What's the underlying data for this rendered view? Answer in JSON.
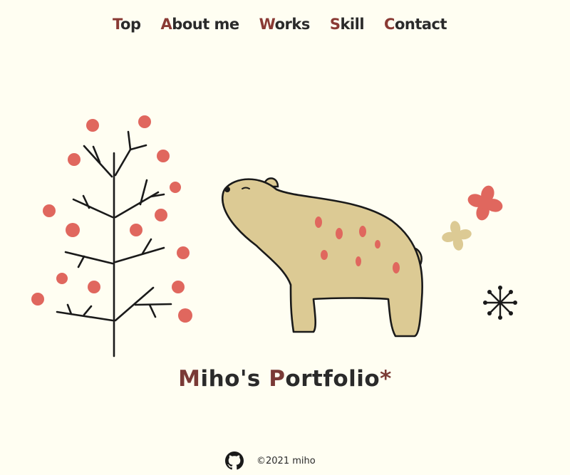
{
  "nav": {
    "items": [
      {
        "first": "T",
        "rest": "op"
      },
      {
        "first": "A",
        "rest": "bout me"
      },
      {
        "first": "W",
        "rest": "orks"
      },
      {
        "first": "S",
        "rest": "kill"
      },
      {
        "first": "C",
        "rest": "ontact"
      }
    ]
  },
  "hero": {
    "title_part1_accent": "M",
    "title_part1_rest": "iho's ",
    "title_part2_accent": "P",
    "title_part2_rest": "ortfolio",
    "title_star": "*"
  },
  "footer": {
    "copyright": "©2021 miho",
    "github_icon": "github-icon"
  },
  "colors": {
    "background": "#fffef2",
    "accent": "#8a3a34",
    "berry": "#e0675e",
    "bear": "#dcca94",
    "ink": "#1a1a1a"
  }
}
